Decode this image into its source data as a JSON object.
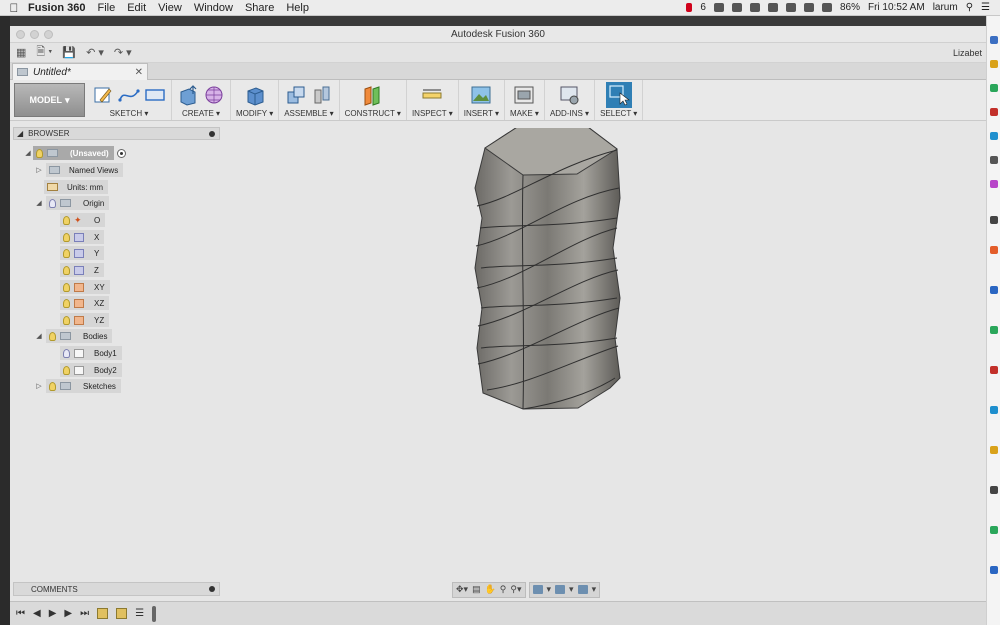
{
  "menubar": {
    "app_name": "Fusion 360",
    "items": [
      "File",
      "Edit",
      "View",
      "Window",
      "Share",
      "Help"
    ],
    "status_count": "6",
    "battery": "86%",
    "clock": "Fri 10:52 AM",
    "user": "larum"
  },
  "window": {
    "title": "Autodesk Fusion 360",
    "user_name": "Lizabet"
  },
  "tab": {
    "title": "Untitled*",
    "close_glyph": "✕"
  },
  "ribbon": {
    "workspace_label": "MODEL",
    "groups": [
      {
        "label": "SKETCH",
        "icons": [
          "sketch-create-icon",
          "spline-icon",
          "rectangle-icon"
        ]
      },
      {
        "label": "CREATE",
        "icons": [
          "extrude-icon",
          "form-icon"
        ]
      },
      {
        "label": "MODIFY",
        "icons": [
          "press-pull-icon"
        ]
      },
      {
        "label": "ASSEMBLE",
        "icons": [
          "new-component-icon",
          "joint-icon"
        ]
      },
      {
        "label": "CONSTRUCT",
        "icons": [
          "offset-plane-icon"
        ]
      },
      {
        "label": "INSPECT",
        "icons": [
          "measure-icon"
        ]
      },
      {
        "label": "INSERT",
        "icons": [
          "insert-image-icon"
        ]
      },
      {
        "label": "MAKE",
        "icons": [
          "make-print-icon"
        ]
      },
      {
        "label": "ADD-INS",
        "icons": [
          "scripts-icon"
        ]
      },
      {
        "label": "SELECT",
        "icons": [
          "select-arrow-icon"
        ]
      }
    ]
  },
  "browser": {
    "title": "BROWSER",
    "root": "(Unsaved)",
    "named_views": "Named Views",
    "units": "Units: mm",
    "origin": "Origin",
    "origin_items": [
      "O",
      "X",
      "Y",
      "Z",
      "XY",
      "XZ",
      "YZ"
    ],
    "bodies": "Bodies",
    "body_items": [
      "Body1",
      "Body2"
    ],
    "sketches": "Sketches"
  },
  "comments": {
    "title": "COMMENTS"
  },
  "colors": {
    "accent": "#2f7fb5",
    "body_fill": "#8a8884",
    "canvas": "#e6e6e6"
  }
}
